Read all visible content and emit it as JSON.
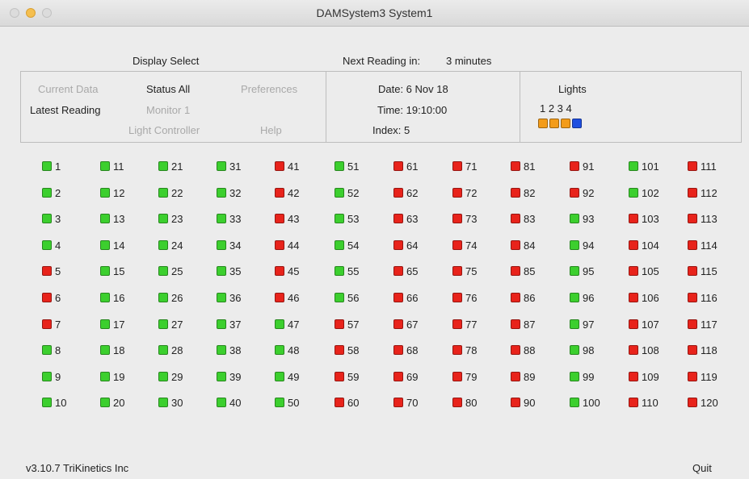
{
  "window": {
    "title": "DAMSystem3   System1"
  },
  "header": {
    "display_select": "Display Select",
    "next_reading_label": "Next Reading in:",
    "next_reading_value": "3 minutes"
  },
  "menu": {
    "current_data": "Current Data",
    "status_all": "Status All",
    "preferences": "Preferences",
    "latest_reading": "Latest Reading",
    "monitor_1": "Monitor 1",
    "light_controller": "Light Controller",
    "help": "Help"
  },
  "info": {
    "date": "Date: 6 Nov 18",
    "time": "Time: 19:10:00",
    "index": "Index: 5"
  },
  "lights": {
    "label": "Lights",
    "numbers": "1  2  3  4",
    "colors": [
      "#f39c1a",
      "#f39c1a",
      "#f39c1a",
      "#1f4fe0"
    ]
  },
  "colors": {
    "green": "#3ccf2e",
    "red": "#e8231b"
  },
  "sensors": [
    {
      "n": "1",
      "s": "green"
    },
    {
      "n": "2",
      "s": "green"
    },
    {
      "n": "3",
      "s": "green"
    },
    {
      "n": "4",
      "s": "green"
    },
    {
      "n": "5",
      "s": "red"
    },
    {
      "n": "6",
      "s": "red"
    },
    {
      "n": "7",
      "s": "red"
    },
    {
      "n": "8",
      "s": "green"
    },
    {
      "n": "9",
      "s": "green"
    },
    {
      "n": "10",
      "s": "green"
    },
    {
      "n": "11",
      "s": "green"
    },
    {
      "n": "12",
      "s": "green"
    },
    {
      "n": "13",
      "s": "green"
    },
    {
      "n": "14",
      "s": "green"
    },
    {
      "n": "15",
      "s": "green"
    },
    {
      "n": "16",
      "s": "green"
    },
    {
      "n": "17",
      "s": "green"
    },
    {
      "n": "18",
      "s": "green"
    },
    {
      "n": "19",
      "s": "green"
    },
    {
      "n": "20",
      "s": "green"
    },
    {
      "n": "21",
      "s": "green"
    },
    {
      "n": "22",
      "s": "green"
    },
    {
      "n": "23",
      "s": "green"
    },
    {
      "n": "24",
      "s": "green"
    },
    {
      "n": "25",
      "s": "green"
    },
    {
      "n": "26",
      "s": "green"
    },
    {
      "n": "27",
      "s": "green"
    },
    {
      "n": "28",
      "s": "green"
    },
    {
      "n": "29",
      "s": "green"
    },
    {
      "n": "30",
      "s": "green"
    },
    {
      "n": "31",
      "s": "green"
    },
    {
      "n": "32",
      "s": "green"
    },
    {
      "n": "33",
      "s": "green"
    },
    {
      "n": "34",
      "s": "green"
    },
    {
      "n": "35",
      "s": "green"
    },
    {
      "n": "36",
      "s": "green"
    },
    {
      "n": "37",
      "s": "green"
    },
    {
      "n": "38",
      "s": "green"
    },
    {
      "n": "39",
      "s": "green"
    },
    {
      "n": "40",
      "s": "green"
    },
    {
      "n": "41",
      "s": "red"
    },
    {
      "n": "42",
      "s": "red"
    },
    {
      "n": "43",
      "s": "red"
    },
    {
      "n": "44",
      "s": "red"
    },
    {
      "n": "45",
      "s": "red"
    },
    {
      "n": "46",
      "s": "red"
    },
    {
      "n": "47",
      "s": "green"
    },
    {
      "n": "48",
      "s": "green"
    },
    {
      "n": "49",
      "s": "green"
    },
    {
      "n": "50",
      "s": "green"
    },
    {
      "n": "51",
      "s": "green"
    },
    {
      "n": "52",
      "s": "green"
    },
    {
      "n": "53",
      "s": "green"
    },
    {
      "n": "54",
      "s": "green"
    },
    {
      "n": "55",
      "s": "green"
    },
    {
      "n": "56",
      "s": "green"
    },
    {
      "n": "57",
      "s": "red"
    },
    {
      "n": "58",
      "s": "red"
    },
    {
      "n": "59",
      "s": "red"
    },
    {
      "n": "60",
      "s": "red"
    },
    {
      "n": "61",
      "s": "red"
    },
    {
      "n": "62",
      "s": "red"
    },
    {
      "n": "63",
      "s": "red"
    },
    {
      "n": "64",
      "s": "red"
    },
    {
      "n": "65",
      "s": "red"
    },
    {
      "n": "66",
      "s": "red"
    },
    {
      "n": "67",
      "s": "red"
    },
    {
      "n": "68",
      "s": "red"
    },
    {
      "n": "69",
      "s": "red"
    },
    {
      "n": "70",
      "s": "red"
    },
    {
      "n": "71",
      "s": "red"
    },
    {
      "n": "72",
      "s": "red"
    },
    {
      "n": "73",
      "s": "red"
    },
    {
      "n": "74",
      "s": "red"
    },
    {
      "n": "75",
      "s": "red"
    },
    {
      "n": "76",
      "s": "red"
    },
    {
      "n": "77",
      "s": "red"
    },
    {
      "n": "78",
      "s": "red"
    },
    {
      "n": "79",
      "s": "red"
    },
    {
      "n": "80",
      "s": "red"
    },
    {
      "n": "81",
      "s": "red"
    },
    {
      "n": "82",
      "s": "red"
    },
    {
      "n": "83",
      "s": "red"
    },
    {
      "n": "84",
      "s": "red"
    },
    {
      "n": "85",
      "s": "red"
    },
    {
      "n": "86",
      "s": "red"
    },
    {
      "n": "87",
      "s": "red"
    },
    {
      "n": "88",
      "s": "red"
    },
    {
      "n": "89",
      "s": "red"
    },
    {
      "n": "90",
      "s": "red"
    },
    {
      "n": "91",
      "s": "red"
    },
    {
      "n": "92",
      "s": "red"
    },
    {
      "n": "93",
      "s": "green"
    },
    {
      "n": "94",
      "s": "green"
    },
    {
      "n": "95",
      "s": "green"
    },
    {
      "n": "96",
      "s": "green"
    },
    {
      "n": "97",
      "s": "green"
    },
    {
      "n": "98",
      "s": "green"
    },
    {
      "n": "99",
      "s": "green"
    },
    {
      "n": "100",
      "s": "green"
    },
    {
      "n": "101",
      "s": "green"
    },
    {
      "n": "102",
      "s": "green"
    },
    {
      "n": "103",
      "s": "red"
    },
    {
      "n": "104",
      "s": "red"
    },
    {
      "n": "105",
      "s": "red"
    },
    {
      "n": "106",
      "s": "red"
    },
    {
      "n": "107",
      "s": "red"
    },
    {
      "n": "108",
      "s": "red"
    },
    {
      "n": "109",
      "s": "red"
    },
    {
      "n": "110",
      "s": "red"
    },
    {
      "n": "111",
      "s": "red"
    },
    {
      "n": "112",
      "s": "red"
    },
    {
      "n": "113",
      "s": "red"
    },
    {
      "n": "114",
      "s": "red"
    },
    {
      "n": "115",
      "s": "red"
    },
    {
      "n": "116",
      "s": "red"
    },
    {
      "n": "117",
      "s": "red"
    },
    {
      "n": "118",
      "s": "red"
    },
    {
      "n": "119",
      "s": "red"
    },
    {
      "n": "120",
      "s": "red"
    }
  ],
  "footer": {
    "version": "v3.10.7  TriKinetics Inc",
    "quit": "Quit"
  }
}
